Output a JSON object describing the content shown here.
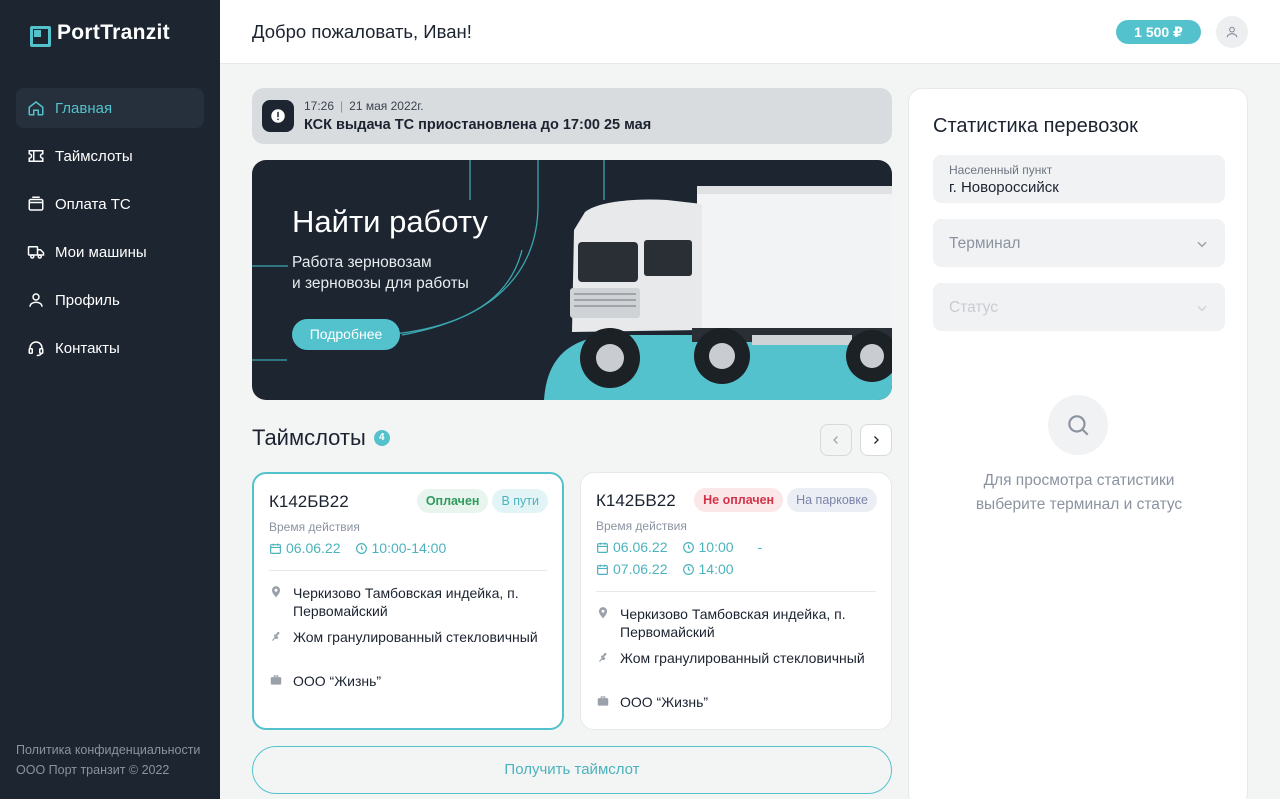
{
  "app": {
    "logo_text": "PortTranzit"
  },
  "sidebar": {
    "items": [
      {
        "label": "Главная",
        "icon": "home-icon",
        "active": true
      },
      {
        "label": "Таймслоты",
        "icon": "ticket-icon"
      },
      {
        "label": "Оплата ТС",
        "icon": "wallet-icon"
      },
      {
        "label": "Мои машины",
        "icon": "truck-icon"
      },
      {
        "label": "Профиль",
        "icon": "user-icon"
      },
      {
        "label": "Контакты",
        "icon": "headset-icon"
      }
    ],
    "footer_policy": "Политика конфиденциальности",
    "footer_copyright": "ООО Порт транзит © 2022"
  },
  "header": {
    "greeting": "Добро пожаловать, Иван!",
    "balance": "1 500 ₽"
  },
  "alert": {
    "time": "17:26",
    "date": "21 мая 2022г.",
    "text": "КСК выдача ТС приостановлена до 17:00 25 мая"
  },
  "banner": {
    "title": "Найти работу",
    "subtitle_line1": "Работа зерновозам",
    "subtitle_line2": "и зерновозы для работы",
    "button": "Подробнее"
  },
  "timeslots": {
    "title": "Таймслоты",
    "count": "4",
    "cards": [
      {
        "plate": "К142БВ22",
        "badge1": "Оплачен",
        "badge2": "В пути",
        "valid_label": "Время действия",
        "date": "06.06.22",
        "time": "10:00-14:00",
        "location": "Черкизово Тамбовская индейка, п. Первомайский",
        "cargo": "Жом гранулированный стекловичный",
        "company": "ООО “Жизнь”"
      },
      {
        "plate": "К142БВ22",
        "badge1": "Не оплачен",
        "badge2": "На парковке",
        "valid_label": "Время действия",
        "date_from": "06.06.22",
        "time_from": "10:00",
        "dash": "-",
        "date_to": "07.06.22",
        "time_to": "14:00",
        "location": "Черкизово Тамбовская индейка, п. Первомайский",
        "cargo": "Жом гранулированный стекловичный",
        "company": "ООО “Жизнь”"
      }
    ],
    "get_button": "Получить таймслот"
  },
  "stats": {
    "title": "Статистика перевозок",
    "city_label": "Населенный пункт",
    "city_value": "г. Новороссийск",
    "terminal_placeholder": "Терминал",
    "status_placeholder": "Статус",
    "empty_line1": "Для просмотра статистики",
    "empty_line2": "выберите терминал и статус"
  },
  "colors": {
    "accent": "#54c2cc",
    "sidebar_bg": "#1d2531",
    "paid": "#2f9a5e",
    "unpaid": "#d4344a"
  }
}
